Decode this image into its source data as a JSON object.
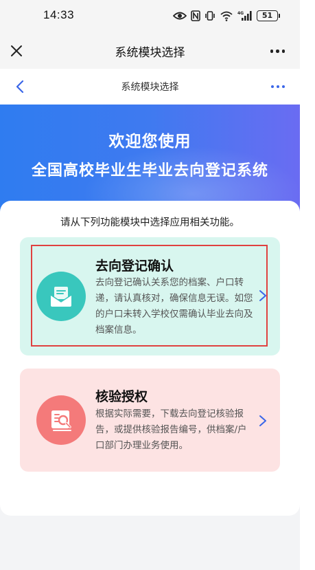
{
  "status_bar": {
    "time": "14:33",
    "battery": "51",
    "network": "4G",
    "icons": [
      "eye-icon",
      "nfc-icon",
      "vibrate-icon",
      "wifi-icon",
      "signal-icon",
      "battery-icon"
    ]
  },
  "app_header": {
    "title": "系统模块选择",
    "close_icon": "close-icon",
    "more_icon": "more-icon"
  },
  "nav_bar": {
    "title": "系统模块选择",
    "back_icon": "chevron-left-icon",
    "more_icon": "more-icon"
  },
  "banner": {
    "line1": "欢迎您使用",
    "line2": "全国高校毕业生毕业去向登记系统"
  },
  "intro": "请从下列功能模块中选择应用相关功能。",
  "modules": [
    {
      "title": "去向登记确认",
      "description": "去向登记确认关系您的档案、户口转递，请认真核对，确保信息无误。如您的户口未转入学校仅需确认毕业去向及档案信息。",
      "icon": "envelope-icon",
      "background": "#d8f6ef",
      "icon_color": "#39c7bd"
    },
    {
      "title": "核验授权",
      "description": "根据实际需要，下载去向登记核验报告，或提供核验报告编号，供档案/户口部门办理业务使用。",
      "icon": "document-search-icon",
      "background": "#fde3e3",
      "icon_color": "#f47a7a"
    }
  ],
  "colors": {
    "accent": "#3a66e8",
    "banner_start": "#2f7cf0",
    "banner_end": "#6a6cf2",
    "highlight": "#e0413f"
  }
}
